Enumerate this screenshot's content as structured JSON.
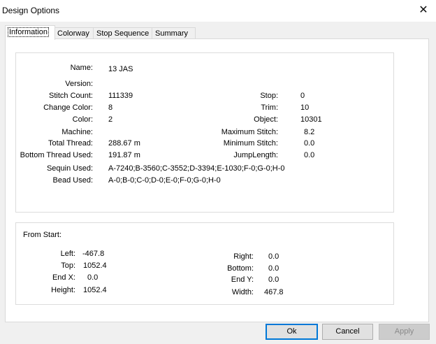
{
  "window": {
    "title": "Design Options",
    "close_glyph": "✕"
  },
  "tabs": [
    {
      "label": "Information"
    },
    {
      "label": "Colorway"
    },
    {
      "label": "Stop Sequence"
    },
    {
      "label": "Summary"
    }
  ],
  "info": {
    "name_label": "Name:",
    "name_value": "13 JAS",
    "version_label": "Version:",
    "stitch_count_label": "Stitch Count:",
    "stitch_count_value": "111339",
    "change_color_label": "Change Color:",
    "change_color_value": "8",
    "color_label": "Color:",
    "color_value": "2",
    "machine_label": "Machine:",
    "total_thread_label": "Total Thread:",
    "total_thread_value": "288.67 m",
    "bottom_thread_label": "Bottom Thread Used:",
    "bottom_thread_value": "191.87 m",
    "sequin_label": "Sequin Used:",
    "sequin_value": "A-7240;B-3560;C-3552;D-3394;E-1030;F-0;G-0;H-0",
    "bead_label": "Bead Used:",
    "bead_value": "A-0;B-0;C-0;D-0;E-0;F-0;G-0;H-0",
    "stop_label": "Stop:",
    "stop_value": "0",
    "trim_label": "Trim:",
    "trim_value": "10",
    "object_label": "Object:",
    "object_value": "10301",
    "max_stitch_label": "Maximum Stitch:",
    "max_stitch_value": "8.2",
    "min_stitch_label": "Minimum Stitch:",
    "min_stitch_value": "0.0",
    "jump_length_label": "JumpLength:",
    "jump_length_value": "0.0"
  },
  "from_start": {
    "heading": "From Start:",
    "left_label": "Left:",
    "left_value": "-467.8",
    "top_label": "Top:",
    "top_value": "1052.4",
    "endx_label": "End X:",
    "endx_value": "0.0",
    "height_label": "Height:",
    "height_value": "1052.4",
    "right_label": "Right:",
    "right_value": "0.0",
    "bottom_label": "Bottom:",
    "bottom_value": "0.0",
    "endy_label": "End Y:",
    "endy_value": "0.0",
    "width_label": "Width:",
    "width_value": "467.8"
  },
  "buttons": {
    "ok": "Ok",
    "cancel": "Cancel",
    "apply": "Apply"
  }
}
